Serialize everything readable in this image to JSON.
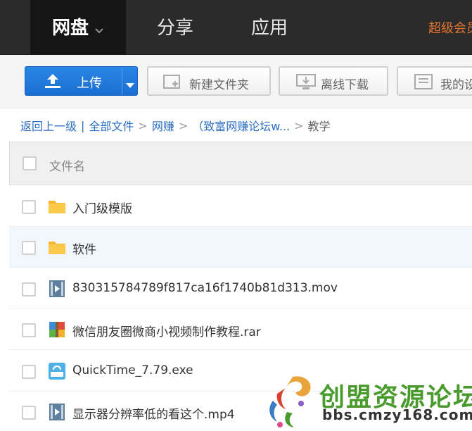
{
  "nav": {
    "tabs": [
      {
        "label": "网盘"
      },
      {
        "label": "分享"
      },
      {
        "label": "应用"
      }
    ],
    "vip_label": "超级会员"
  },
  "toolbar": {
    "upload_label": "上传",
    "new_folder_label": "新建文件夹",
    "offline_label": "离线下载",
    "mine_label": "我的设备"
  },
  "breadcrumb": {
    "back": "返回上一级",
    "divider": "|",
    "items": [
      "全部文件",
      "网赚",
      "（致富网赚论坛w...",
      "教学"
    ],
    "separator": ">"
  },
  "list": {
    "header_label": "文件名",
    "files": [
      {
        "name": "入门级模版",
        "icon": "folder-icon"
      },
      {
        "name": "软件",
        "icon": "folder-icon"
      },
      {
        "name": "830315784789f817ca16f1740b81d313.mov",
        "icon": "video-icon"
      },
      {
        "name": "微信朋友圈微商小视频制作教程.rar",
        "icon": "archive-icon"
      },
      {
        "name": "QuickTime_7.79.exe",
        "icon": "exe-icon"
      },
      {
        "name": "显示器分辨率低的看这个.mp4",
        "icon": "video-icon"
      }
    ]
  },
  "watermark": {
    "title": "创盟资源论坛",
    "url": "bbs.cmzy168.com"
  },
  "colors": {
    "nav_bg": "#2b2b2b",
    "nav_active": "#151515",
    "vip": "#e2742f",
    "upload_blue": "#1a6fd1",
    "link": "#2a6dc2",
    "row_highlight": "#f2f7fd",
    "watermark_green": "#4a9b2e"
  }
}
